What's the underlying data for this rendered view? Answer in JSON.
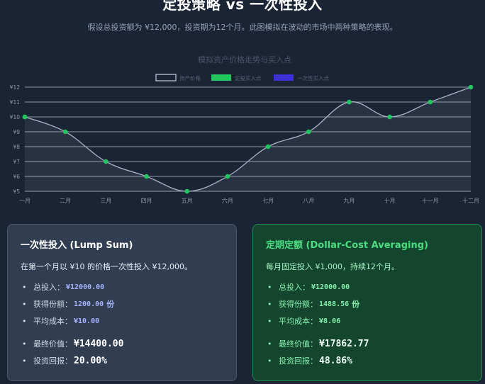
{
  "header": {
    "title": "定投策略 vs 一次性投入",
    "subtitle": "假设总投资额为 ¥12,000，投资期为12个月。此图模拟在波动的市场中两种策略的表现。"
  },
  "chart_data": {
    "type": "line",
    "title": "模拟资产价格走势与买入点",
    "categories": [
      "一月",
      "二月",
      "三月",
      "四月",
      "五月",
      "六月",
      "七月",
      "八月",
      "九月",
      "十月",
      "十一月",
      "十二月"
    ],
    "series": [
      {
        "name": "资产价格",
        "values": [
          10,
          9,
          7,
          6,
          5,
          6,
          8,
          9,
          11,
          10,
          11,
          12
        ]
      },
      {
        "name": "定投买入点",
        "values": [
          10,
          9,
          7,
          6,
          5,
          6,
          8,
          9,
          11,
          10,
          11,
          12
        ]
      },
      {
        "name": "一次性买入点",
        "values": [
          10,
          null,
          null,
          null,
          null,
          null,
          null,
          null,
          null,
          null,
          null,
          null
        ]
      }
    ],
    "y_ticks": [
      "¥5",
      "¥6",
      "¥7",
      "¥8",
      "¥9",
      "¥10",
      "¥11",
      "¥12"
    ],
    "ylim": [
      5,
      12
    ],
    "grid": true,
    "legend_position": "top-center",
    "colors": {
      "line": "#a3aec2",
      "dca": "#22c55e",
      "lump": "#3b31d6",
      "area": "#2c3547",
      "grid": "#c9d1de",
      "tick": "#8d97a8"
    }
  },
  "lump_card": {
    "title": "一次性投入 (Lump Sum)",
    "desc": "在第一个月以 ¥10 的价格一次性投入 ¥12,000。",
    "total_label": "总投入：",
    "total_value": "¥12000.00",
    "shares_label": "获得份额：",
    "shares_value": "1200.00",
    "shares_unit": "份",
    "cost_label": "平均成本：",
    "cost_value": "¥10.00",
    "final_label": "最终价值：",
    "final_value": "¥14400.00",
    "return_label": "投资回报：",
    "return_value": "20.00%"
  },
  "dca_card": {
    "title": "定期定额 (Dollar-Cost Averaging)",
    "desc": "每月固定投入 ¥1,000，持续12个月。",
    "total_label": "总投入：",
    "total_value": "¥12000.00",
    "shares_label": "获得份额：",
    "shares_value": "1488.56",
    "shares_unit": "份",
    "cost_label": "平均成本：",
    "cost_value": "¥8.06",
    "final_label": "最终价值：",
    "final_value": "¥17862.77",
    "return_label": "投资回报：",
    "return_value": "48.86%"
  }
}
